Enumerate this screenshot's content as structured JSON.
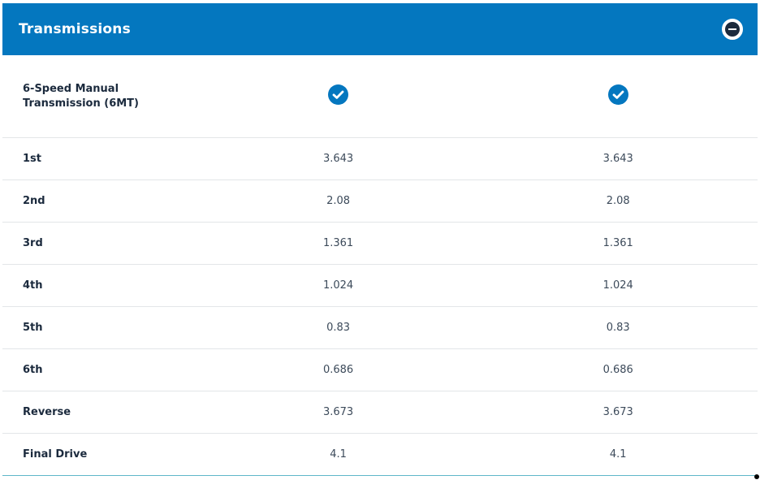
{
  "section": {
    "title": "Transmissions",
    "collapse_icon": "minus-circle-icon"
  },
  "colors": {
    "header_bg": "#0477bf",
    "check_bg": "#0477bf",
    "divider": "#e3e6e8",
    "bottom_border": "#5fb7c9"
  },
  "rows": [
    {
      "label": "6-Speed Manual Transmission (6MT)",
      "col1": "check-circle-icon",
      "col2": "check-circle-icon"
    },
    {
      "label": "1st",
      "col1": "3.643",
      "col2": "3.643"
    },
    {
      "label": "2nd",
      "col1": "2.08",
      "col2": "2.08"
    },
    {
      "label": "3rd",
      "col1": "1.361",
      "col2": "1.361"
    },
    {
      "label": "4th",
      "col1": "1.024",
      "col2": "1.024"
    },
    {
      "label": "5th",
      "col1": "0.83",
      "col2": "0.83"
    },
    {
      "label": "6th",
      "col1": "0.686",
      "col2": "0.686"
    },
    {
      "label": "Reverse",
      "col1": "3.673",
      "col2": "3.673"
    },
    {
      "label": "Final Drive",
      "col1": "4.1",
      "col2": "4.1"
    }
  ]
}
